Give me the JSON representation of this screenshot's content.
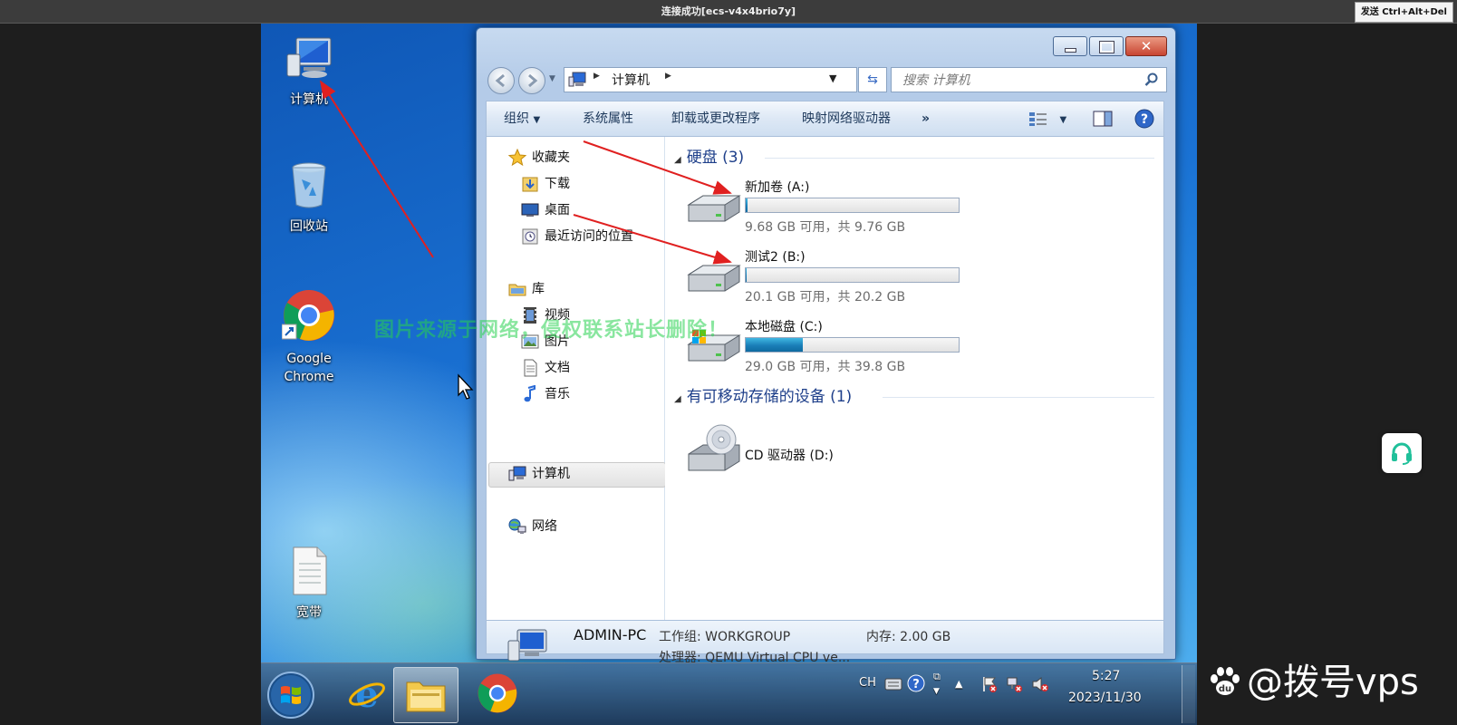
{
  "session": {
    "title": "连接成功[ecs-v4x4brio7y]",
    "send_cad": "发送 Ctrl+Alt+Del"
  },
  "desktop": {
    "icons": [
      {
        "label": "计算机",
        "icon": "computer-icon"
      },
      {
        "label": "回收站",
        "icon": "recycle-bin-icon"
      },
      {
        "label": "Google Chrome",
        "icon": "chrome-icon"
      },
      {
        "label": "宽带",
        "icon": "text-file-icon"
      }
    ]
  },
  "explorer": {
    "breadcrumb": "计算机",
    "search_placeholder": "搜索 计算机",
    "toolbar": {
      "organize": "组织",
      "system_properties": "系统属性",
      "uninstall": "卸载或更改程序",
      "map_drive": "映射网络驱动器",
      "more": "»"
    },
    "nav": {
      "favorites": "收藏夹",
      "downloads": "下载",
      "desktop": "桌面",
      "recent": "最近访问的位置",
      "libraries": "库",
      "videos": "视频",
      "pictures": "图片",
      "documents": "文档",
      "music": "音乐",
      "computer": "计算机",
      "network": "网络"
    },
    "groups": {
      "hard_disks": "硬盘 (3)",
      "removable": "有可移动存储的设备 (1)"
    },
    "drives": [
      {
        "name": "新加卷 (A:)",
        "space": "9.68 GB 可用，共 9.76 GB",
        "used_fraction": 0.01
      },
      {
        "name": "测试2 (B:)",
        "space": "20.1 GB 可用，共 20.2 GB",
        "used_fraction": 0.005
      },
      {
        "name": "本地磁盘 (C:)",
        "space": "29.0 GB 可用，共 39.8 GB",
        "used_fraction": 0.27
      }
    ],
    "cd_drive": "CD 驱动器 (D:)",
    "details": {
      "pc_name": "ADMIN-PC",
      "workgroup": "工作组: WORKGROUP",
      "memory": "内存: 2.00 GB",
      "processor": "处理器: QEMU Virtual CPU ve..."
    }
  },
  "taskbar": {
    "lang": "CH",
    "time": "5:27",
    "date": "2023/11/30"
  },
  "overlay": {
    "watermark": "图片来源于网络，侵权联系站长删除！",
    "brand": "@拨号vps"
  },
  "colors": {
    "accent": "#1e3f8a",
    "annotation_arrow": "#e02020",
    "watermark": "#28d250"
  }
}
